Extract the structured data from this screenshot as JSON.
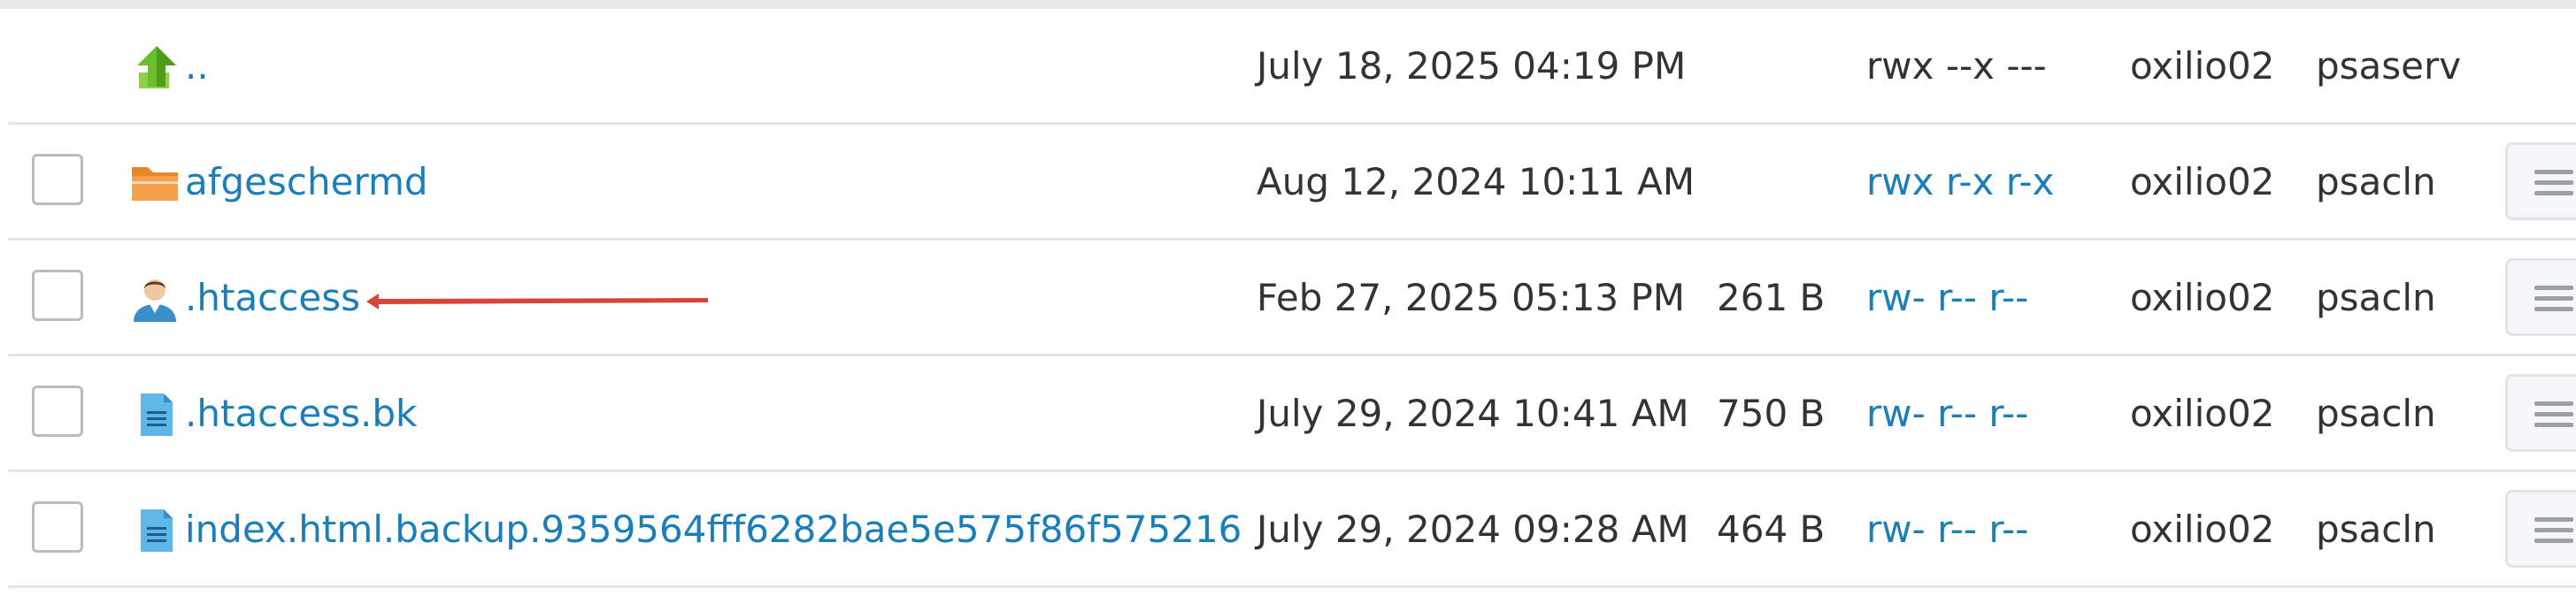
{
  "files": [
    {
      "name": "..",
      "type": "parent-directory",
      "date": "July 18, 2025 04:19 PM",
      "size": "",
      "permissions": "rwx --x ---",
      "permissions_link": false,
      "owner": "oxilio02",
      "group": "psaserv",
      "has_checkbox": false,
      "has_menu": false
    },
    {
      "name": "afgeschermd",
      "type": "folder",
      "date": "Aug 12, 2024 10:11 AM",
      "size": "",
      "permissions": "rwx r-x r-x",
      "permissions_link": true,
      "owner": "oxilio02",
      "group": "psacln",
      "has_checkbox": true,
      "has_menu": true
    },
    {
      "name": ".htaccess",
      "type": "user-file",
      "date": "Feb 27, 2025 05:13 PM",
      "size": "261 B",
      "permissions": "rw- r-- r--",
      "permissions_link": true,
      "owner": "oxilio02",
      "group": "psacln",
      "has_checkbox": true,
      "has_menu": true
    },
    {
      "name": ".htaccess.bk",
      "type": "text-file",
      "date": "July 29, 2024 10:41 AM",
      "size": "750 B",
      "permissions": "rw- r-- r--",
      "permissions_link": true,
      "owner": "oxilio02",
      "group": "psacln",
      "has_checkbox": true,
      "has_menu": true
    },
    {
      "name": "index.html.backup.9359564fff6282bae5e575f86f575216",
      "type": "text-file",
      "date": "July 29, 2024 09:28 AM",
      "size": "464 B",
      "permissions": "rw- r-- r--",
      "permissions_link": true,
      "owner": "oxilio02",
      "group": "psacln",
      "has_checkbox": true,
      "has_menu": true
    }
  ],
  "colors": {
    "link": "#1a7fb8",
    "text": "#333333",
    "annotation_arrow": "#d9443a",
    "folder": "#f5a04a",
    "text_file": "#5fb7e8",
    "up_arrow": "#6cbf2c"
  },
  "icons": {
    "parent-directory": "up-arrow-icon",
    "folder": "folder-icon",
    "user-file": "user-icon",
    "text-file": "text-file-icon"
  }
}
